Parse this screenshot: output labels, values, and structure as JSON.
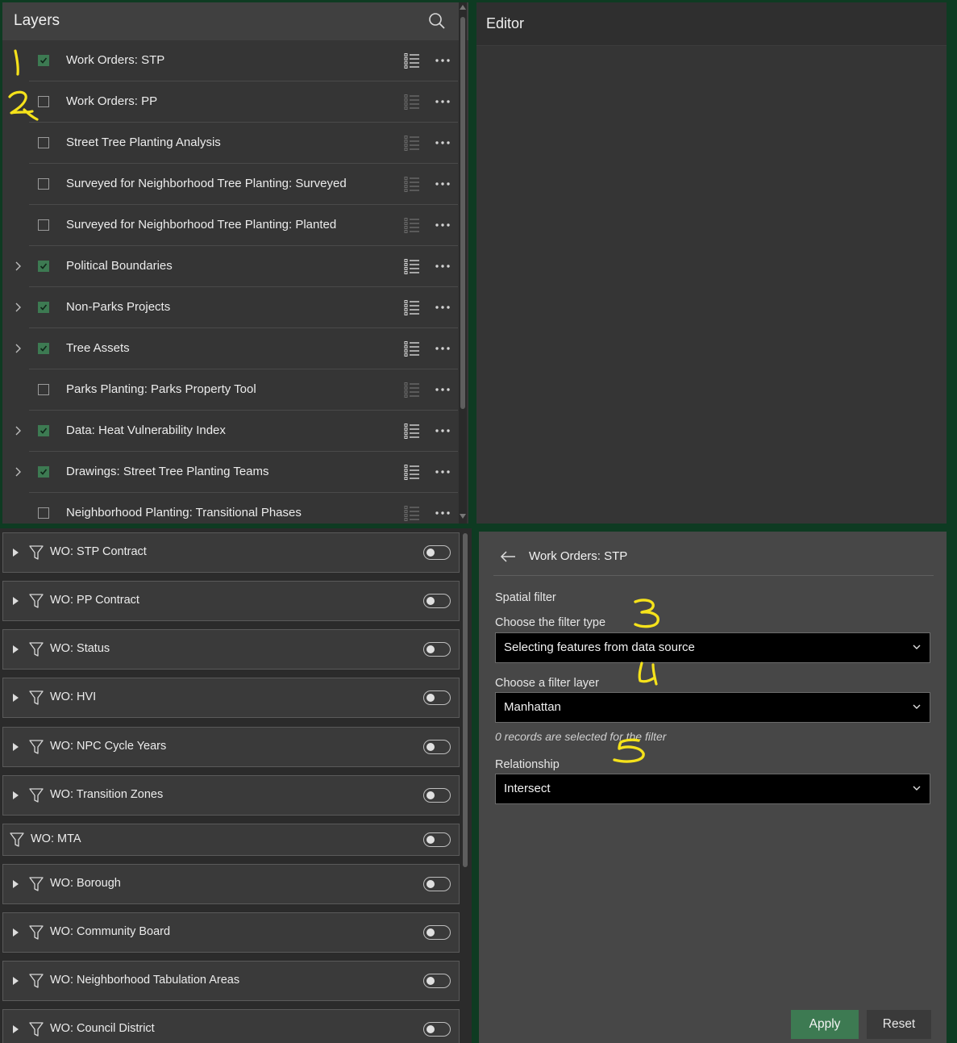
{
  "layers_panel": {
    "title": "Layers",
    "items": [
      {
        "label": "Work Orders: STP",
        "checked": true,
        "expandable": false,
        "legend_active": true
      },
      {
        "label": "Work Orders: PP",
        "checked": false,
        "expandable": false,
        "legend_active": false
      },
      {
        "label": "Street Tree Planting Analysis",
        "checked": false,
        "expandable": false,
        "legend_active": false
      },
      {
        "label": "Surveyed for Neighborhood Tree Planting: Surveyed",
        "checked": false,
        "expandable": false,
        "legend_active": false
      },
      {
        "label": "Surveyed for Neighborhood Tree Planting: Planted",
        "checked": false,
        "expandable": false,
        "legend_active": false
      },
      {
        "label": "Political Boundaries",
        "checked": true,
        "expandable": true,
        "legend_active": true
      },
      {
        "label": "Non-Parks Projects",
        "checked": true,
        "expandable": true,
        "legend_active": true
      },
      {
        "label": "Tree Assets",
        "checked": true,
        "expandable": true,
        "legend_active": true
      },
      {
        "label": "Parks Planting: Parks Property Tool",
        "checked": false,
        "expandable": false,
        "legend_active": false
      },
      {
        "label": "Data: Heat Vulnerability Index",
        "checked": true,
        "expandable": true,
        "legend_active": true
      },
      {
        "label": "Drawings: Street Tree Planting Teams",
        "checked": true,
        "expandable": true,
        "legend_active": true
      },
      {
        "label": "Neighborhood Planting: Transitional Phases",
        "checked": false,
        "expandable": false,
        "legend_active": false
      }
    ]
  },
  "editor_panel": {
    "title": "Editor"
  },
  "filter_list": {
    "items": [
      {
        "label": "WO: STP Contract",
        "expandable": true,
        "enabled": false
      },
      {
        "label": "WO: PP Contract",
        "expandable": true,
        "enabled": false
      },
      {
        "label": "WO: Status",
        "expandable": true,
        "enabled": false
      },
      {
        "label": "WO: HVI",
        "expandable": true,
        "enabled": false
      },
      {
        "label": "WO: NPC Cycle Years",
        "expandable": true,
        "enabled": false
      },
      {
        "label": "WO: Transition Zones",
        "expandable": true,
        "enabled": false
      },
      {
        "label": "WO: MTA",
        "expandable": false,
        "enabled": false
      },
      {
        "label": "WO: Borough",
        "expandable": true,
        "enabled": false
      },
      {
        "label": "WO: Community Board",
        "expandable": true,
        "enabled": false
      },
      {
        "label": "WO: Neighborhood Tabulation Areas",
        "expandable": true,
        "enabled": false
      },
      {
        "label": "WO: Council District",
        "expandable": true,
        "enabled": false
      }
    ]
  },
  "filter_settings": {
    "title": "Work Orders: STP",
    "section_label": "Spatial filter",
    "filter_type_label": "Choose the filter type",
    "filter_type_value": "Selecting features from data source",
    "filter_layer_label": "Choose a filter layer",
    "filter_layer_value": "Manhattan",
    "records_note": "0 records are selected for the filter",
    "relationship_label": "Relationship",
    "relationship_value": "Intersect",
    "apply_label": "Apply",
    "reset_label": "Reset"
  },
  "annotations": [
    "1",
    "2",
    "3",
    "4",
    "5"
  ],
  "colors": {
    "accent_green": "#3d7a52",
    "annotation_yellow": "#f5e21b",
    "frame_green": "#0e3b22"
  }
}
